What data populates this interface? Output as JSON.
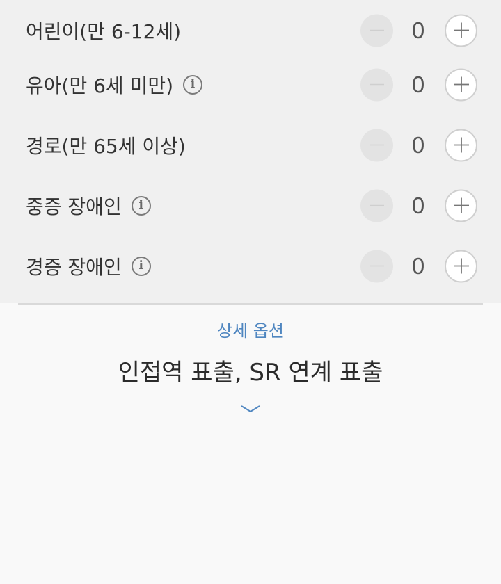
{
  "passengers": [
    {
      "label": "어린이(만 6-12세)",
      "count": "0",
      "has_info": false
    },
    {
      "label": "유아(만 6세 미만)",
      "count": "0",
      "has_info": true
    },
    {
      "label": "경로(만 65세 이상)",
      "count": "0",
      "has_info": false
    },
    {
      "label": "중증 장애인",
      "count": "0",
      "has_info": true
    },
    {
      "label": "경증 장애인",
      "count": "0",
      "has_info": true
    }
  ],
  "icons": {
    "info": "i",
    "minus": "minus-icon",
    "plus": "plus-icon",
    "expand": "chevron-down-icon"
  },
  "details": {
    "label": "상세 옵션",
    "summary": "인접역 표출, SR 연계 표출"
  },
  "colors": {
    "panel_bg": "#f0f0f0",
    "page_bg": "#f9f9f9",
    "accent": "#4f86c0",
    "minus_disabled": "#e3e3e3"
  }
}
